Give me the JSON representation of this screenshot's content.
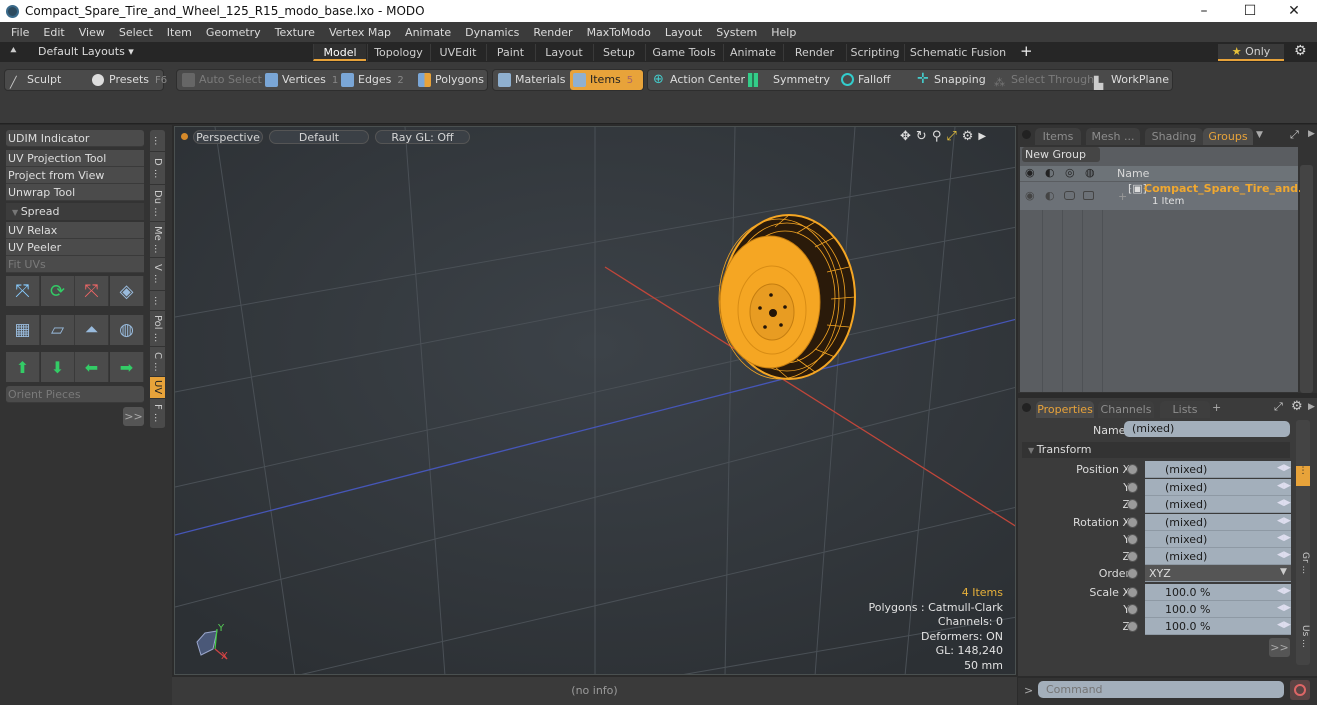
{
  "window": {
    "title": "Compact_Spare_Tire_and_Wheel_125_R15_modo_base.lxo - MODO",
    "controls": [
      "minimize",
      "maximize",
      "close"
    ]
  },
  "menu": [
    "File",
    "Edit",
    "View",
    "Select",
    "Item",
    "Geometry",
    "Texture",
    "Vertex Map",
    "Animate",
    "Dynamics",
    "Render",
    "MaxToModo",
    "Layout",
    "System",
    "Help"
  ],
  "layoutbar": {
    "layouts_label": "Default Layouts ▾",
    "tabs": [
      "Model",
      "Topology",
      "UVEdit",
      "Paint",
      "Layout",
      "Setup",
      "Game Tools",
      "Animate",
      "Render",
      "Scripting",
      "Schematic Fusion"
    ],
    "active_tab": "Model",
    "add_label": "+",
    "only_label": "Only"
  },
  "toolbar": {
    "sculpt": "Sculpt",
    "presets": "Presets",
    "presets_key": "F6",
    "auto_select": "Auto Select",
    "vertices": "Vertices",
    "vertices_key": "1",
    "edges": "Edges",
    "edges_key": "2",
    "polygons": "Polygons",
    "materials": "Materials",
    "items": "Items",
    "items_key": "5",
    "action_center": "Action Center",
    "symmetry": "Symmetry",
    "falloff": "Falloff",
    "snapping": "Snapping",
    "select_through": "Select Through",
    "workplane": "WorkPlane"
  },
  "leftpanel": {
    "udim": "UDIM Indicator",
    "tools": [
      "UV Projection Tool",
      "Project from View",
      "Unwrap Tool"
    ],
    "spread_header": "Spread",
    "relax_tools": [
      "UV Relax",
      "UV Peeler",
      "Fit UVs"
    ],
    "orient_pieces": "Orient Pieces",
    "more": ">>",
    "vtabs": [
      "...",
      "D ...",
      "Du ...",
      "Me ...",
      "V ...",
      "...",
      "Pol ...",
      "C ...",
      "UV",
      "F ..."
    ],
    "active_vtab": "UV"
  },
  "viewport": {
    "view_mode": "Perspective",
    "shading": "Default",
    "raygl": "Ray GL: Off",
    "hud": {
      "items": "4 Items",
      "polygons": "Polygons : Catmull-Clark",
      "channels": "Channels: 0",
      "deformers": "Deformers: ON",
      "gl": "GL: 148,240",
      "grid": "50 mm"
    },
    "axis": {
      "x": "X",
      "y": "Y"
    }
  },
  "status": "(no info)",
  "groups_panel": {
    "tabs": [
      "Items",
      "Mesh ...",
      "Shading",
      "Groups"
    ],
    "active_tab": "Groups",
    "new_group": "New Group",
    "col_name": "Name",
    "rows": [
      {
        "name": "Compact_Spare_Tire_and...",
        "sub": "1 Item"
      }
    ]
  },
  "properties_panel": {
    "tabs": [
      "Properties",
      "Channels",
      "Lists"
    ],
    "active_tab": "Properties",
    "add": "+",
    "name_label": "Name",
    "name_value": "(mixed)",
    "section": "Transform",
    "rows": [
      {
        "label": "Position X",
        "value": "(mixed)"
      },
      {
        "label": "Y",
        "value": "(mixed)"
      },
      {
        "label": "Z",
        "value": "(mixed)"
      },
      {
        "label": "Rotation X",
        "value": "(mixed)"
      },
      {
        "label": "Y",
        "value": "(mixed)"
      },
      {
        "label": "Z",
        "value": "(mixed)"
      },
      {
        "label": "Order",
        "value": "XYZ"
      },
      {
        "label": "Scale X",
        "value": "100.0 %"
      },
      {
        "label": "Y",
        "value": "100.0 %"
      },
      {
        "label": "Z",
        "value": "100.0 %"
      }
    ],
    "more": ">>",
    "vtabs": [
      "...",
      "...",
      "...",
      "...",
      "Gr ...",
      "...",
      "...",
      "Us ..."
    ]
  },
  "command": {
    "prompt": ">",
    "placeholder": "Command"
  },
  "colors": {
    "accent": "#e8a33a",
    "selection": "#f5a623",
    "x_axis": "#c0463a",
    "z_axis": "#4656b8"
  }
}
